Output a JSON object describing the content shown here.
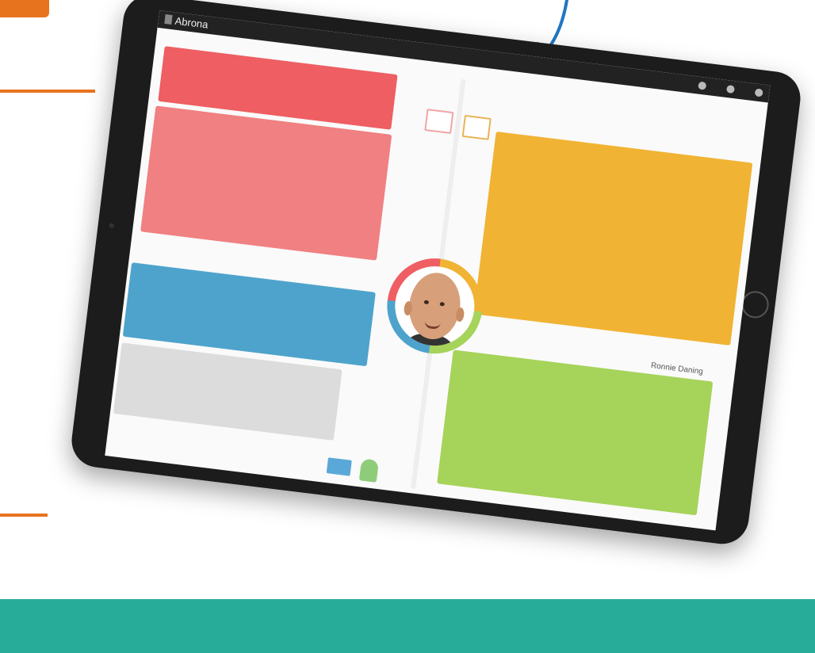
{
  "app": {
    "title": "Abrona"
  },
  "user": {
    "name": "Ronnie Daning"
  }
}
